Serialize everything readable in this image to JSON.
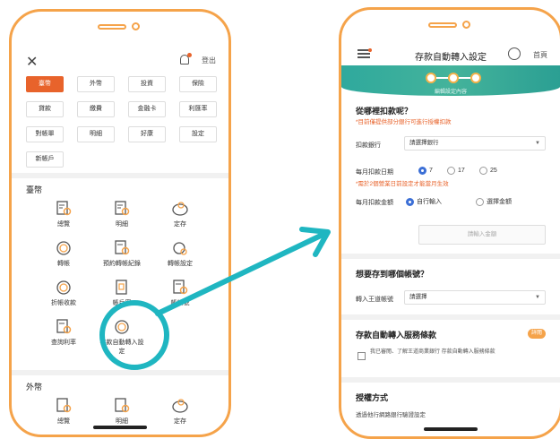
{
  "left_screen": {
    "header": {
      "close_icon": "close-icon",
      "bell_icon": "bell-icon",
      "logout_label": "登出"
    },
    "category_buttons": [
      {
        "label": "臺幣",
        "active": true
      },
      {
        "label": "外幣",
        "active": false
      },
      {
        "label": "投資",
        "active": false
      },
      {
        "label": "保險",
        "active": false
      },
      {
        "label": "貸款",
        "active": false
      },
      {
        "label": "繳費",
        "active": false
      },
      {
        "label": "金融卡",
        "active": false
      },
      {
        "label": "利匯率",
        "active": false
      },
      {
        "label": "對帳單",
        "active": false
      },
      {
        "label": "明細",
        "active": false
      },
      {
        "label": "好康",
        "active": false
      },
      {
        "label": "設定",
        "active": false
      },
      {
        "label": "新帳戶",
        "active": false
      }
    ],
    "twd_section": {
      "title": "臺幣",
      "items": [
        {
          "label": "總覽",
          "icon": "overview-icon"
        },
        {
          "label": "明細",
          "icon": "details-icon"
        },
        {
          "label": "定存",
          "icon": "piggy-bank-icon"
        },
        {
          "label": "轉帳",
          "icon": "transfer-icon"
        },
        {
          "label": "預約轉帳紀錄",
          "icon": "details-icon"
        },
        {
          "label": "轉帳設定",
          "icon": "transfer-settings-icon"
        },
        {
          "label": "折帳收款",
          "icon": "transfer-icon"
        },
        {
          "label": "帳戶密",
          "icon": "document-icon"
        },
        {
          "label": "帳帳號",
          "icon": "details-icon"
        },
        {
          "label": "查詢利率",
          "icon": "details-icon"
        },
        {
          "label": "存款自動轉入設定",
          "icon": "auto-deposit-icon"
        }
      ]
    },
    "fx_section": {
      "title": "外幣",
      "items": [
        {
          "label": "總覽",
          "icon": "overview-icon"
        },
        {
          "label": "明細",
          "icon": "details-icon"
        },
        {
          "label": "定存",
          "icon": "piggy-bank-icon"
        }
      ]
    }
  },
  "right_screen": {
    "header": {
      "title": "存款自動轉入設定",
      "home_label": "首頁",
      "menu_icon": "menu-icon",
      "help_icon": "help-icon"
    },
    "steps": {
      "label": "編輯設定內容",
      "count": 3,
      "current": 1
    },
    "source": {
      "question": "從哪裡扣款呢？",
      "note": "*目前僅提供部分銀行可進行授權扣款",
      "bank_label": "扣款銀行",
      "bank_placeholder": "請選擇銀行",
      "date_label": "每月扣款日期",
      "date_options": [
        "7",
        "17",
        "25"
      ],
      "date_selected": "7",
      "date_note": "*需於2個營業日前設定才能當月生效",
      "amount_label": "每月扣款金額",
      "amount_options": [
        "自行輸入",
        "選擇金額"
      ],
      "amount_selected": "自行輸入",
      "amount_placeholder": "請輸入金額"
    },
    "target": {
      "question": "想要存到哪個帳號？",
      "account_label": "轉入王道帳號",
      "account_placeholder": "請選擇"
    },
    "terms": {
      "title": "存款自動轉入服務條款",
      "badge": "詳閱",
      "agree_text": "我已審閱、了解王道商業銀行 存款自動轉入服務條款"
    },
    "auth": {
      "title": "授權方式",
      "desc": "透過他行網路銀行驗證設定"
    }
  },
  "colors": {
    "frame": "#f5a34a",
    "accent": "#e8632b",
    "teal": "#1fb6c1",
    "header_green": "#2fa99d",
    "radio": "#3b6fd6"
  }
}
